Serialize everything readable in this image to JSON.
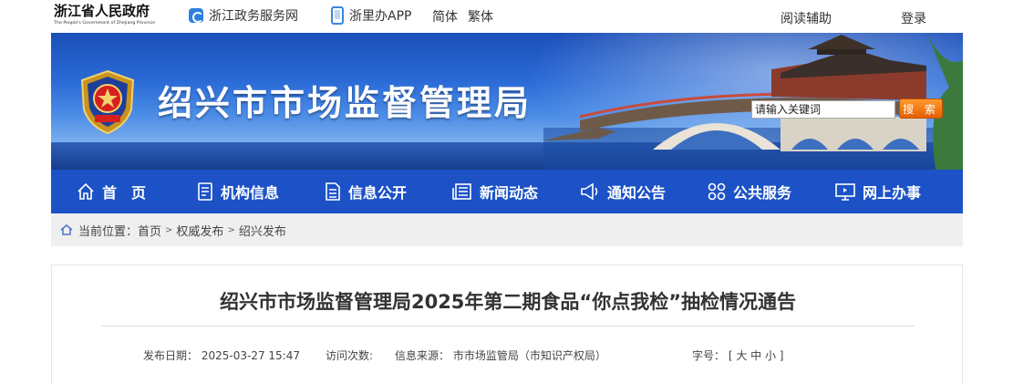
{
  "topbar": {
    "gov_name": "浙江省人民政府",
    "gov_name_en": "The People's Government of Zhejiang Province",
    "zjzw_link": "浙江政务服务网",
    "app_link": "浙里办APP",
    "simplified": "简体",
    "traditional": "繁体",
    "reading_aid": "阅读辅助",
    "login": "登录"
  },
  "banner": {
    "site_title": "绍兴市市场监督管理局",
    "search_value": "请输入关键词",
    "search_button": "搜 索"
  },
  "nav": {
    "items": [
      {
        "label": "首　页",
        "icon": "home-icon"
      },
      {
        "label": "机构信息",
        "icon": "document-list-icon"
      },
      {
        "label": "信息公开",
        "icon": "document-icon"
      },
      {
        "label": "新闻动态",
        "icon": "newspaper-icon"
      },
      {
        "label": "通知公告",
        "icon": "megaphone-icon"
      },
      {
        "label": "公共服务",
        "icon": "grid-icon"
      },
      {
        "label": "网上办事",
        "icon": "monitor-icon"
      }
    ]
  },
  "breadcrumb": {
    "prefix": "当前位置：",
    "items": [
      "首页",
      "权威发布",
      "绍兴发布"
    ],
    "separator": ">"
  },
  "article": {
    "title": "绍兴市市场监督管理局2025年第二期食品“你点我检”抽检情况通告",
    "publish_date_label": "发布日期：",
    "publish_date": "2025-03-27 15:47",
    "visits_label": "访问次数:",
    "source_label": "信息来源：",
    "source": "市市场监管局（市知识产权局）",
    "font_size_label": "字号：",
    "font_size_options": "[ 大 中 小 ]"
  },
  "colors": {
    "nav_blue": "#1c52c6",
    "search_orange": "#e65f00",
    "breadcrumb_bg": "#efefef"
  }
}
